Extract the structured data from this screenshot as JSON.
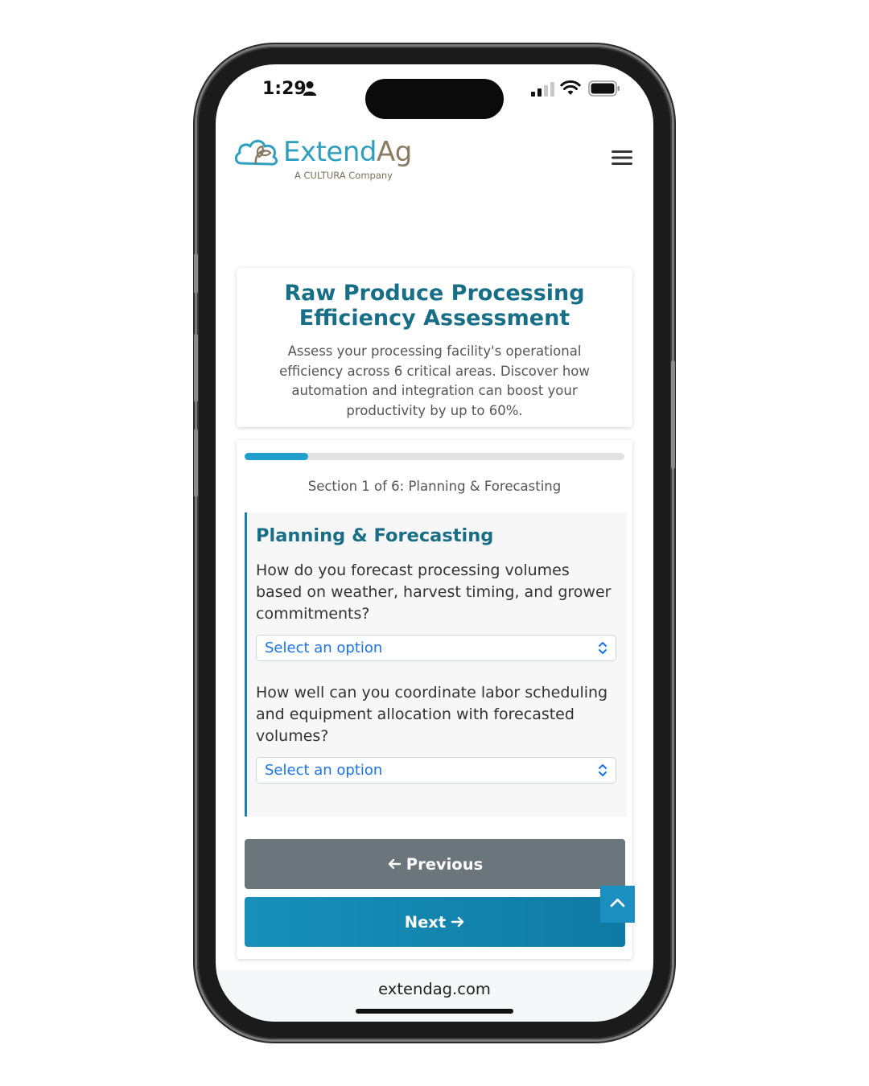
{
  "status_bar": {
    "time": "1:29"
  },
  "brand": {
    "name_part1": "Extend",
    "name_part2": "Ag",
    "tagline": "A CULTURA Company"
  },
  "header": {
    "title": "Raw Produce Processing Efficiency Assessment",
    "description": "Assess your processing facility's operational efficiency across 6 critical areas. Discover how automation and integration can boost your productivity by up to 60%."
  },
  "progress": {
    "fraction": 0.1667,
    "label": "Section 1 of 6: Planning & Forecasting"
  },
  "section": {
    "title": "Planning & Forecasting",
    "questions": [
      {
        "text": "How do you forecast processing volumes based on weather, harvest timing, and grower commitments?",
        "select_value": "Select an option"
      },
      {
        "text": "How well can you coordinate labor scheduling and equipment allocation with forecasted volumes?",
        "select_value": "Select an option"
      }
    ]
  },
  "buttons": {
    "previous": "Previous",
    "next": "Next"
  },
  "browser": {
    "url": "extendag.com"
  },
  "colors": {
    "brand_teal": "#176e86",
    "accent_blue": "#1f9fcc",
    "previous_button": "#6b757c",
    "select_text": "#1a73e8"
  }
}
